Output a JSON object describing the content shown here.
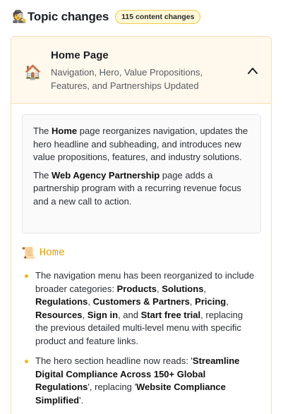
{
  "header": {
    "emoji": "🕵️",
    "title": "Topic changes",
    "badge": "115 content changes"
  },
  "card": {
    "icon_name": "house-icon",
    "icon": "🏠",
    "title": "Home Page",
    "subtitle": "Navigation, Hero, Value Propositions, Features, and Partnerships Updated",
    "summary": {
      "p1": {
        "pre": "The ",
        "bold": "Home",
        "post": " page reorganizes navigation, updates the hero headline and subheading, and introduces new value propositions, features, and industry solutions."
      },
      "p2": {
        "pre": "The ",
        "bold": "Web Agency Partnership",
        "post": " page adds a partnership program with a recurring revenue focus and a new call to action."
      }
    },
    "section": {
      "icon": "📜",
      "icon_name": "scroll-icon",
      "name": "Home"
    },
    "changes": [
      {
        "parts": [
          {
            "t": "The navigation menu has been reorganized to include broader categories: "
          },
          {
            "t": "Products",
            "b": true
          },
          {
            "t": ", "
          },
          {
            "t": "Solutions",
            "b": true
          },
          {
            "t": ", "
          },
          {
            "t": "Regulations",
            "b": true
          },
          {
            "t": ", "
          },
          {
            "t": "Customers & Partners",
            "b": true
          },
          {
            "t": ", "
          },
          {
            "t": "Pricing",
            "b": true
          },
          {
            "t": ", "
          },
          {
            "t": "Resources",
            "b": true
          },
          {
            "t": ", "
          },
          {
            "t": "Sign in",
            "b": true
          },
          {
            "t": ", and "
          },
          {
            "t": "Start free trial",
            "b": true
          },
          {
            "t": ", replacing the previous detailed multi-level menu with specific product and feature links."
          }
        ]
      },
      {
        "parts": [
          {
            "t": "The hero section headline now reads: '"
          },
          {
            "t": "Streamline Digital Compliance Across 150+ Global Regulations",
            "b": true
          },
          {
            "t": "', replacing '"
          },
          {
            "t": "Website Compliance Simplified",
            "b": true
          },
          {
            "t": "'."
          }
        ]
      }
    ]
  },
  "colors": {
    "badge_border": "#f2c94c",
    "badge_bg": "#fff8d6",
    "card_border": "#f6dfb5",
    "card_head_bg": "#fff8ec",
    "bullet": "#f5b800",
    "section_name": "#e0a100"
  }
}
